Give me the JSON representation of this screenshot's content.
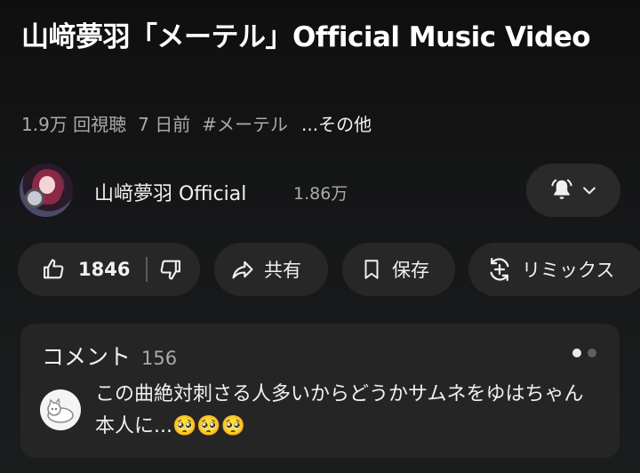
{
  "video": {
    "title": "山﨑夢羽「メーテル」Official Music Video",
    "views": "1.9万 回視聴",
    "age": "7 日前",
    "hashtag": "#メーテル",
    "more": "...その他"
  },
  "channel": {
    "name": "山﨑夢羽 Official",
    "subscribers": "1.86万"
  },
  "actions": {
    "like_count": "1846",
    "share_label": "共有",
    "save_label": "保存",
    "remix_label": "リミックス"
  },
  "comments": {
    "title": "コメント",
    "count": "156",
    "top_comment": "この曲絶対刺さる人多いからどうかサムネをゆはちゃん本人に...🥺🥺🥺"
  },
  "colors": {
    "background": "#0f0f0f",
    "pill": "#272727",
    "secondary_text": "#aaaaaa"
  },
  "icons": [
    "like-icon",
    "dislike-icon",
    "share-icon",
    "save-icon",
    "remix-icon",
    "bell-icon",
    "chevron-down-icon"
  ]
}
